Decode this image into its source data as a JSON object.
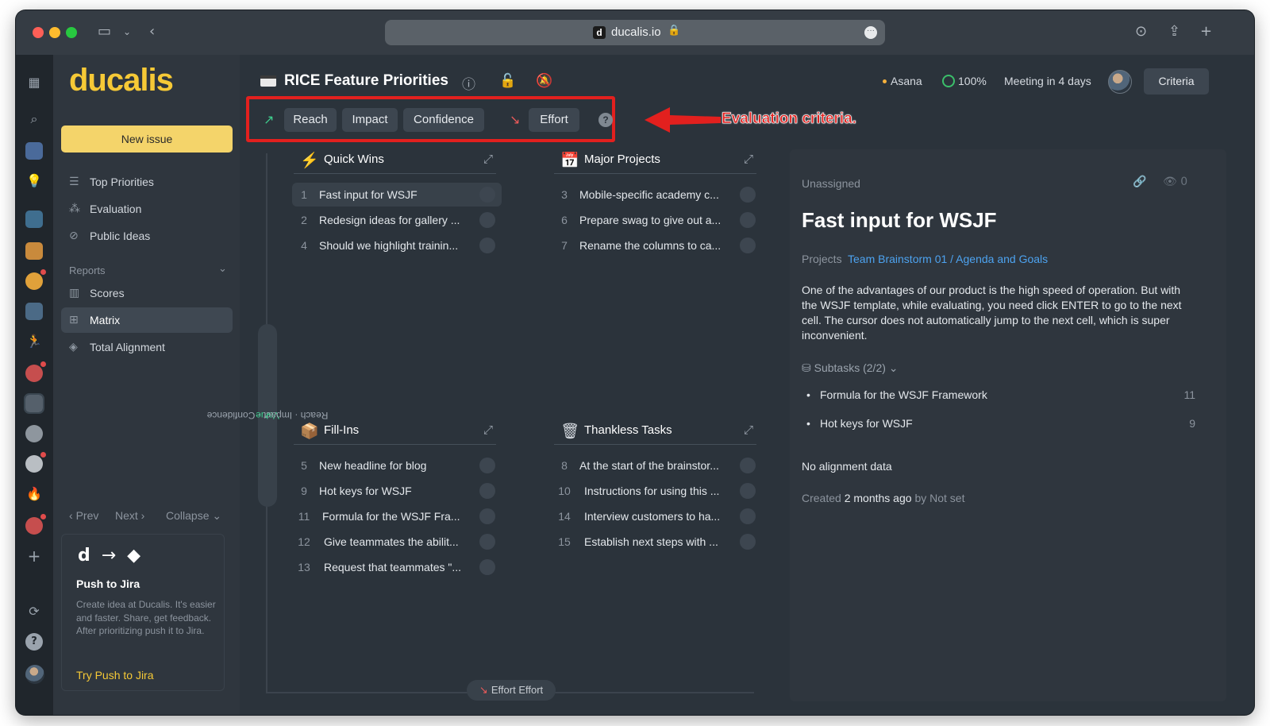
{
  "browser": {
    "url": "ducalis.io",
    "url_favicon": "d"
  },
  "app": {
    "logo": "ducalis",
    "new_issue": "New issue",
    "nav": [
      {
        "label": "Top Priorities",
        "icon": "list-icon"
      },
      {
        "label": "Evaluation",
        "icon": "evaluation-icon"
      },
      {
        "label": "Public Ideas",
        "icon": "public-ideas-icon"
      }
    ],
    "reports_heading": "Reports",
    "reports": [
      {
        "label": "Scores",
        "icon": "scores-icon",
        "active": false
      },
      {
        "label": "Matrix",
        "icon": "matrix-icon",
        "active": true
      },
      {
        "label": "Total Alignment",
        "icon": "alignment-icon",
        "active": false
      }
    ],
    "pager": {
      "prev": "Prev",
      "next": "Next",
      "collapse": "Collapse"
    },
    "jira_card": {
      "title": "Push to Jira",
      "description": "Create idea at Ducalis. It's easier and faster. Share, get feedback. After prioritizing push it to Jira.",
      "link": "Try Push to Jira"
    }
  },
  "header": {
    "title": "RICE Feature Priorities",
    "integration": "Asana",
    "progress": "100%",
    "meeting": "Meeting in 4 days",
    "criteria_button": "Criteria"
  },
  "criteria": {
    "value_chips": [
      "Reach",
      "Impact",
      "Confidence"
    ],
    "effort_chips": [
      "Effort"
    ],
    "annotation": "Evaluation criteria."
  },
  "axes": {
    "vertical_prefix": "Value",
    "vertical": "Reach · Impact · Confidence",
    "horizontal_prefix": "Effort",
    "horizontal": "Effort"
  },
  "quadrants": [
    {
      "title": "Quick Wins",
      "icon": "lightning-icon",
      "items": [
        {
          "num": "1",
          "text": "Fast input for WSJF",
          "selected": true
        },
        {
          "num": "2",
          "text": "Redesign ideas for gallery ...",
          "selected": false
        },
        {
          "num": "4",
          "text": "Should we highlight trainin...",
          "selected": false
        }
      ]
    },
    {
      "title": "Major Projects",
      "icon": "calendar-icon",
      "items": [
        {
          "num": "3",
          "text": "Mobile-specific academy c...",
          "selected": false
        },
        {
          "num": "6",
          "text": "Prepare swag to give out a...",
          "selected": false
        },
        {
          "num": "7",
          "text": "Rename the columns to ca...",
          "selected": false
        }
      ]
    },
    {
      "title": "Fill-Ins",
      "icon": "box-icon",
      "items": [
        {
          "num": "5",
          "text": "New headline for blog",
          "selected": false
        },
        {
          "num": "9",
          "text": "Hot keys for WSJF",
          "selected": false
        },
        {
          "num": "11",
          "text": "Formula for the WSJF Fra...",
          "selected": false
        },
        {
          "num": "12",
          "text": "Give teammates the abilit...",
          "selected": false
        },
        {
          "num": "13",
          "text": "Request that teammates \"...",
          "selected": false
        }
      ]
    },
    {
      "title": "Thankless Tasks",
      "icon": "trash-icon",
      "items": [
        {
          "num": "8",
          "text": "At the start of the brainstor...",
          "selected": false
        },
        {
          "num": "10",
          "text": "Instructions for using this ...",
          "selected": false
        },
        {
          "num": "14",
          "text": "Interview customers to ha...",
          "selected": false
        },
        {
          "num": "15",
          "text": "Establish next steps with ...",
          "selected": false
        }
      ]
    }
  ],
  "detail": {
    "assignee": "Unassigned",
    "views": "0",
    "title": "Fast input for WSJF",
    "projects_label": "Projects",
    "projects_value": "Team Brainstorm 01 / Agenda and Goals",
    "description": "One of the advantages of our product is the high speed of operation. But with the WSJF template, while evaluating, you need click ENTER to go to the next cell. The cursor does not automatically jump to the next cell, which is super inconvenient.",
    "subtasks_label": "Subtasks (2/2)",
    "subtasks": [
      {
        "text": "Formula for the WSJF Framework",
        "num": "11"
      },
      {
        "text": "Hot keys for WSJF",
        "num": "9"
      }
    ],
    "alignment": "No alignment data",
    "created_label": "Created",
    "created_when": "2 months ago",
    "created_by_label": "by",
    "created_by": "Not set"
  },
  "colors": {
    "brand": "#f6c936",
    "background": "#2b333b",
    "annotation_red": "#e2201e",
    "link_blue": "#4da3f0"
  }
}
